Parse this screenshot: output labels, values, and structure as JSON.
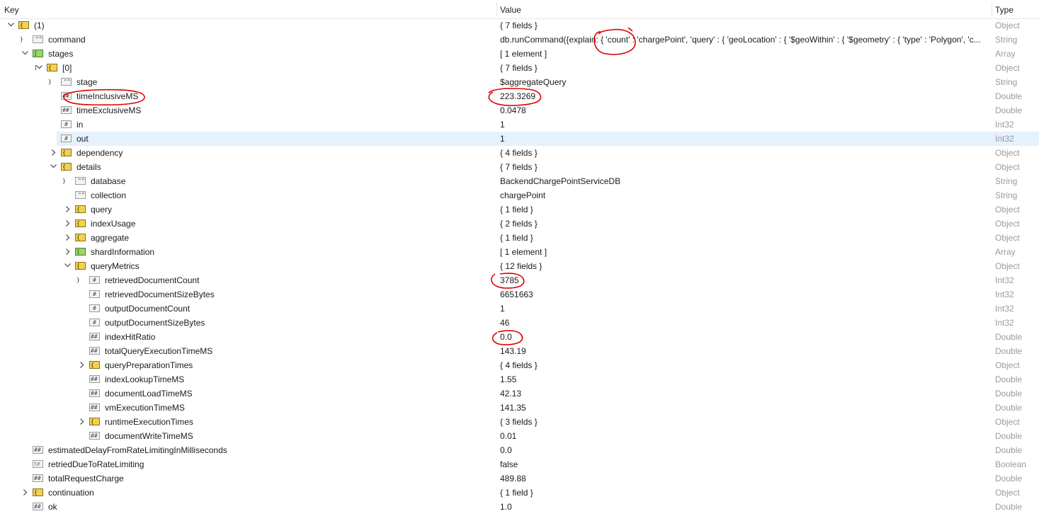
{
  "header": {
    "key": "Key",
    "value": "Value",
    "type": "Type"
  },
  "rows": [
    {
      "key": "(1)",
      "value": "{ 7 fields }",
      "type": "Object",
      "depth": 0,
      "chev": "down",
      "icon": "obj"
    },
    {
      "key": "command",
      "value": "db.runCommand({explain: { 'count' : 'chargePoint', 'query' : { 'geoLocation' : { '$geoWithin' : { '$geometry' : { 'type' : 'Polygon', 'c...",
      "type": "String",
      "depth": 1,
      "chev": "",
      "icon": "str"
    },
    {
      "key": "stages",
      "value": "[ 1 element ]",
      "type": "Array",
      "depth": 1,
      "chev": "down",
      "icon": "arr"
    },
    {
      "key": "[0]",
      "value": "{ 7 fields }",
      "type": "Object",
      "depth": 2,
      "chev": "down",
      "icon": "obj"
    },
    {
      "key": "stage",
      "value": "$aggregateQuery",
      "type": "String",
      "depth": 3,
      "chev": "",
      "icon": "str"
    },
    {
      "key": "timeInclusiveMS",
      "value": "223.3269",
      "type": "Double",
      "depth": 3,
      "chev": "",
      "icon": "dbl"
    },
    {
      "key": "timeExclusiveMS",
      "value": "0.0478",
      "type": "Double",
      "depth": 3,
      "chev": "",
      "icon": "dbl"
    },
    {
      "key": "in",
      "value": "1",
      "type": "Int32",
      "depth": 3,
      "chev": "",
      "icon": "num"
    },
    {
      "key": "out",
      "value": "1",
      "type": "Int32",
      "depth": 3,
      "chev": "",
      "icon": "num",
      "selected": true
    },
    {
      "key": "dependency",
      "value": "{ 4 fields }",
      "type": "Object",
      "depth": 3,
      "chev": "right",
      "icon": "obj"
    },
    {
      "key": "details",
      "value": "{ 7 fields }",
      "type": "Object",
      "depth": 3,
      "chev": "down",
      "icon": "obj"
    },
    {
      "key": "database",
      "value": "BackendChargePointServiceDB",
      "type": "String",
      "depth": 4,
      "chev": "",
      "icon": "str"
    },
    {
      "key": "collection",
      "value": "chargePoint",
      "type": "String",
      "depth": 4,
      "chev": "",
      "icon": "str"
    },
    {
      "key": "query",
      "value": "{ 1 field }",
      "type": "Object",
      "depth": 4,
      "chev": "right",
      "icon": "obj"
    },
    {
      "key": "indexUsage",
      "value": "{ 2 fields }",
      "type": "Object",
      "depth": 4,
      "chev": "right",
      "icon": "obj"
    },
    {
      "key": "aggregate",
      "value": "{ 1 field }",
      "type": "Object",
      "depth": 4,
      "chev": "right",
      "icon": "obj"
    },
    {
      "key": "shardInformation",
      "value": "[ 1 element ]",
      "type": "Array",
      "depth": 4,
      "chev": "right",
      "icon": "arr"
    },
    {
      "key": "queryMetrics",
      "value": "{ 12 fields }",
      "type": "Object",
      "depth": 4,
      "chev": "down",
      "icon": "obj"
    },
    {
      "key": "retrievedDocumentCount",
      "value": "3785",
      "type": "Int32",
      "depth": 5,
      "chev": "",
      "icon": "num"
    },
    {
      "key": "retrievedDocumentSizeBytes",
      "value": "6651663",
      "type": "Int32",
      "depth": 5,
      "chev": "",
      "icon": "num"
    },
    {
      "key": "outputDocumentCount",
      "value": "1",
      "type": "Int32",
      "depth": 5,
      "chev": "",
      "icon": "num"
    },
    {
      "key": "outputDocumentSizeBytes",
      "value": "46",
      "type": "Int32",
      "depth": 5,
      "chev": "",
      "icon": "num"
    },
    {
      "key": "indexHitRatio",
      "value": "0.0",
      "type": "Double",
      "depth": 5,
      "chev": "",
      "icon": "dbl"
    },
    {
      "key": "totalQueryExecutionTimeMS",
      "value": "143.19",
      "type": "Double",
      "depth": 5,
      "chev": "",
      "icon": "dbl"
    },
    {
      "key": "queryPreparationTimes",
      "value": "{ 4 fields }",
      "type": "Object",
      "depth": 5,
      "chev": "right",
      "icon": "obj"
    },
    {
      "key": "indexLookupTimeMS",
      "value": "1.55",
      "type": "Double",
      "depth": 5,
      "chev": "",
      "icon": "dbl"
    },
    {
      "key": "documentLoadTimeMS",
      "value": "42.13",
      "type": "Double",
      "depth": 5,
      "chev": "",
      "icon": "dbl"
    },
    {
      "key": "vmExecutionTimeMS",
      "value": "141.35",
      "type": "Double",
      "depth": 5,
      "chev": "",
      "icon": "dbl"
    },
    {
      "key": "runtimeExecutionTimes",
      "value": "{ 3 fields }",
      "type": "Object",
      "depth": 5,
      "chev": "right",
      "icon": "obj"
    },
    {
      "key": "documentWriteTimeMS",
      "value": "0.01",
      "type": "Double",
      "depth": 5,
      "chev": "",
      "icon": "dbl"
    },
    {
      "key": "estimatedDelayFromRateLimitingInMilliseconds",
      "value": "0.0",
      "type": "Double",
      "depth": 1,
      "chev": "",
      "icon": "dbl"
    },
    {
      "key": "retriedDueToRateLimiting",
      "value": "false",
      "type": "Boolean",
      "depth": 1,
      "chev": "",
      "icon": "bool"
    },
    {
      "key": "totalRequestCharge",
      "value": "489.88",
      "type": "Double",
      "depth": 1,
      "chev": "",
      "icon": "dbl"
    },
    {
      "key": "continuation",
      "value": "{ 1 field }",
      "type": "Object",
      "depth": 1,
      "chev": "right",
      "icon": "obj"
    },
    {
      "key": "ok",
      "value": "1.0",
      "type": "Double",
      "depth": 1,
      "chev": "",
      "icon": "dbl"
    }
  ],
  "annotation_color": "#e00000"
}
